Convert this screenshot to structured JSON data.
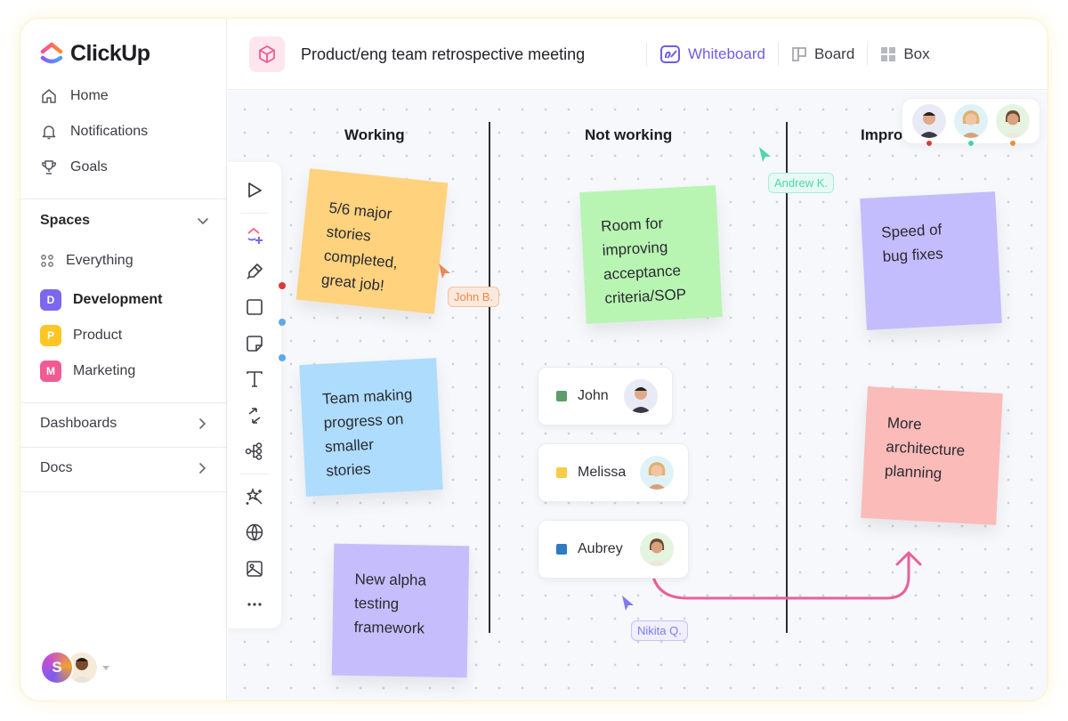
{
  "app": {
    "name": "ClickUp"
  },
  "sidebar": {
    "nav": [
      {
        "label": "Home",
        "icon": "home-icon"
      },
      {
        "label": "Notifications",
        "icon": "bell-icon"
      },
      {
        "label": "Goals",
        "icon": "trophy-icon"
      }
    ],
    "spaces_title": "Spaces",
    "spaces": [
      {
        "label": "Everything",
        "icon": "grid-dots-icon"
      },
      {
        "label": "Development",
        "badge": "D",
        "color": "#7b68ee",
        "active": true
      },
      {
        "label": "Product",
        "badge": "P",
        "color": "#fdc624"
      },
      {
        "label": "Marketing",
        "badge": "M",
        "color": "#f25a94"
      }
    ],
    "sections": [
      {
        "label": "Dashboards"
      },
      {
        "label": "Docs"
      }
    ],
    "user": {
      "initial": "S"
    }
  },
  "header": {
    "title": "Product/eng team retrospective meeting",
    "tabs": [
      {
        "label": "Whiteboard",
        "active": true
      },
      {
        "label": "Board"
      },
      {
        "label": "Box"
      }
    ]
  },
  "whiteboard": {
    "columns": [
      {
        "title": "Working"
      },
      {
        "title": "Not working"
      },
      {
        "title": "Impro"
      }
    ],
    "toolbar": [
      "cursor-icon",
      "clickup-add-icon",
      "pen-icon",
      "rectangle-icon",
      "sticky-note-icon",
      "text-icon",
      "connector-icon",
      "mindmap-icon",
      "magic-wand-icon",
      "globe-icon",
      "image-icon",
      "more-icon"
    ],
    "stickies": [
      {
        "text": "5/6 major\nstories\ncompleted,\ngreat job!",
        "color": "#ffd27e"
      },
      {
        "text": "Team making\nprogress on\nsmaller\nstories",
        "color": "#aedcfd"
      },
      {
        "text": "New alpha\ntesting\nframework",
        "color": "#c6befc"
      },
      {
        "text": "Room for\nimproving\nacceptance\ncriteria/SOP",
        "color": "#b8f5b3"
      },
      {
        "text": "Speed of\nbug fixes",
        "color": "#c3bdfd"
      },
      {
        "text": "More\narchitecture\nplanning",
        "color": "#fbbbb9"
      }
    ],
    "people": [
      {
        "name": "John",
        "color": "#5e9c6a"
      },
      {
        "name": "Melissa",
        "color": "#f9cb4a"
      },
      {
        "name": "Aubrey",
        "color": "#2f7ac4"
      }
    ],
    "cursors": [
      {
        "name": "John B.",
        "color": "#e88b4f"
      },
      {
        "name": "Andrew K.",
        "color": "#4fd6ac"
      },
      {
        "name": "Nikita Q.",
        "color": "#7d7bef"
      }
    ],
    "presence_dots": [
      "#d93b3b",
      "#3dd6a2",
      "#f08b3a"
    ],
    "connector_color": "#e9609a"
  }
}
